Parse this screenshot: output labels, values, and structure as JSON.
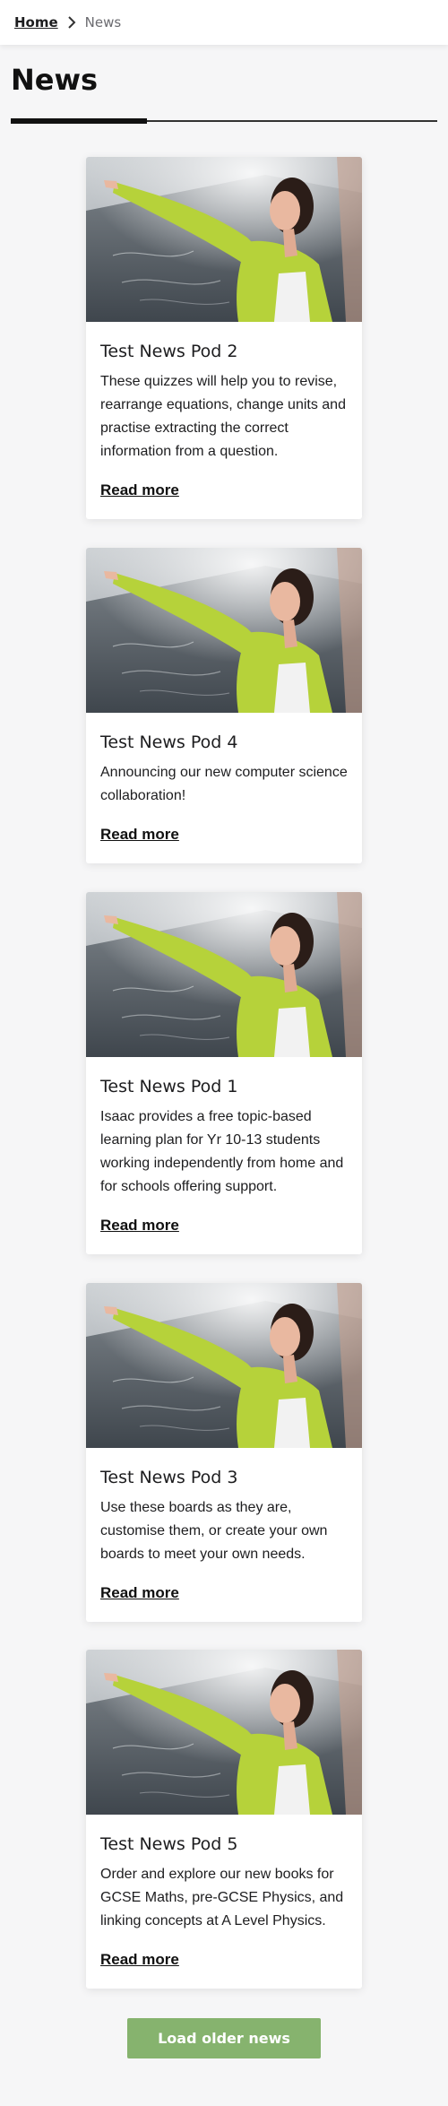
{
  "breadcrumb": {
    "home": "Home",
    "current": "News"
  },
  "page": {
    "title": "News"
  },
  "cards": [
    {
      "title": "Test News Pod 2",
      "text": "These quizzes will help you to revise, rearrange equations, change units and practise extracting the correct information from a question.",
      "link": "Read more"
    },
    {
      "title": "Test News Pod 4",
      "text": "Announcing our new computer science collaboration!",
      "link": "Read more"
    },
    {
      "title": "Test News Pod 1",
      "text": "Isaac provides a free topic-based learning plan for Yr 10-13 students working independently from home and for schools offering support.",
      "link": "Read more"
    },
    {
      "title": "Test News Pod 3",
      "text": "Use these boards as they are, customise them, or create your own boards to meet your own needs.",
      "link": "Read more"
    },
    {
      "title": "Test News Pod 5",
      "text": "Order and explore our new books for GCSE Maths, pre-GCSE Physics, and linking concepts at A Level Physics.",
      "link": "Read more"
    }
  ],
  "load_more": {
    "label": "Load older news"
  },
  "colors": {
    "accent": "#86b36e",
    "sweater": "#b6d23a"
  }
}
